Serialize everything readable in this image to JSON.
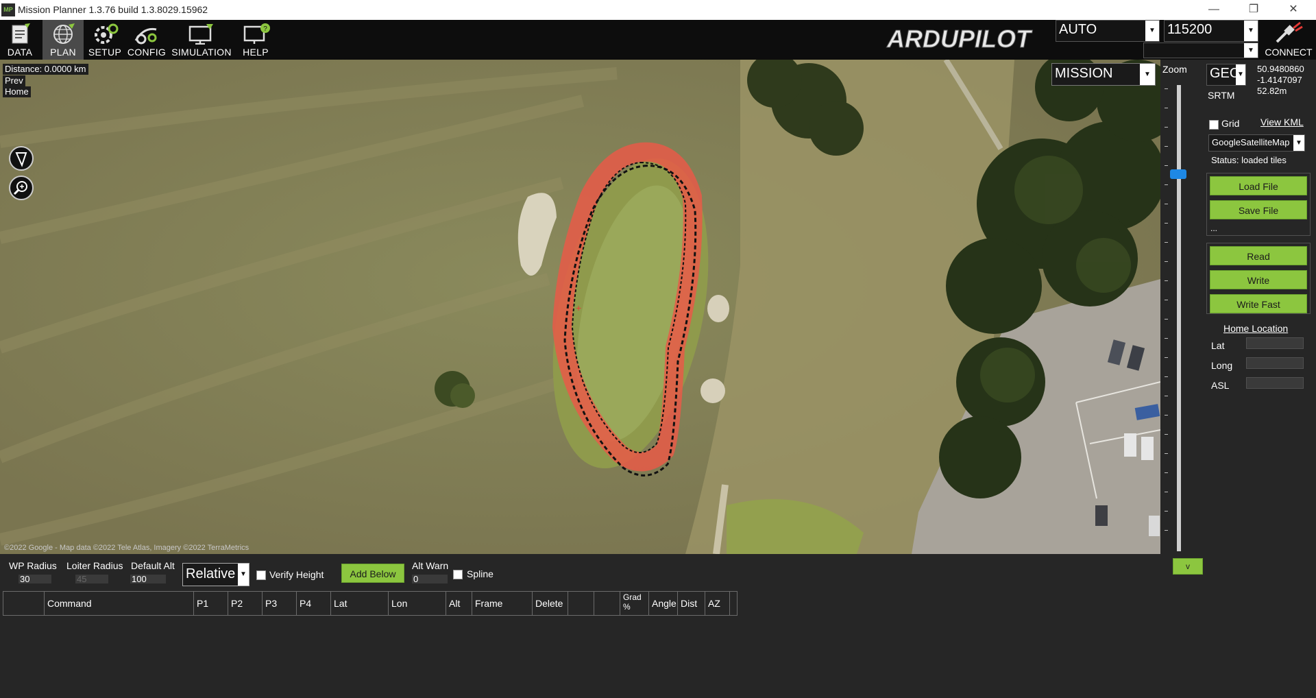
{
  "window": {
    "title": "Mission Planner 1.3.76 build 1.3.8029.15962",
    "app_icon": "MP",
    "controls": [
      "minimize-icon",
      "restore-icon",
      "close-icon"
    ]
  },
  "toolbar": {
    "buttons": [
      {
        "label": "DATA",
        "icon": "data-icon"
      },
      {
        "label": "PLAN",
        "icon": "globe-icon",
        "active": true
      },
      {
        "label": "SETUP",
        "icon": "setup-icon"
      },
      {
        "label": "CONFIG",
        "icon": "config-icon"
      },
      {
        "label": "SIMULATION",
        "icon": "simulation-icon"
      },
      {
        "label": "HELP",
        "icon": "help-icon"
      }
    ],
    "logo": "ARDUPILOT",
    "mode": "AUTO",
    "baud": "115200",
    "port": "",
    "connect_label": "CONNECT"
  },
  "map": {
    "distance": "Distance: 0.0000 km",
    "prev": "Prev",
    "home": "Home",
    "layer": "MISSION",
    "copyright": "©2022 Google - Map data ©2022 Tele Atlas, Imagery ©2022 TerraMetrics"
  },
  "zoom": {
    "label": "Zoom"
  },
  "right_panel": {
    "coord_system": "GEO",
    "lat": "50.9480860",
    "lng": "-1.4147097",
    "alt": "52.82m",
    "srtm": "SRTM",
    "grid_label": "Grid",
    "view_kml": "View KML",
    "map_type": "GoogleSatelliteMap",
    "status": "Status: loaded tiles",
    "load_file": "Load File",
    "save_file": "Save File",
    "more": "...",
    "read": "Read",
    "write": "Write",
    "write_fast": "Write Fast",
    "home_location": "Home Location",
    "lat_label": "Lat",
    "long_label": "Long",
    "asl_label": "ASL"
  },
  "bottom": {
    "wp_radius_label": "WP Radius",
    "wp_radius": "30",
    "loiter_radius_label": "Loiter Radius",
    "loiter_radius": "45",
    "default_alt_label": "Default Alt",
    "default_alt": "100",
    "frame": "Relative",
    "verify_height": "Verify Height",
    "add_below": "Add Below",
    "alt_warn_label": "Alt Warn",
    "alt_warn": "0",
    "spline": "Spline",
    "v_label": "v",
    "columns": [
      "",
      "Command",
      "P1",
      "P2",
      "P3",
      "P4",
      "Lat",
      "Lon",
      "Alt",
      "Frame",
      "Delete",
      "",
      "",
      "Grad %",
      "Angle",
      "Dist",
      "AZ"
    ]
  }
}
